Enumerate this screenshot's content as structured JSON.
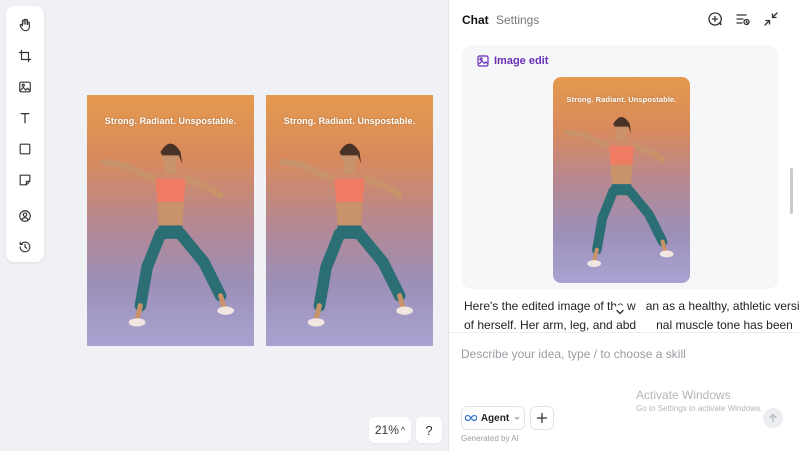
{
  "toolbar": {
    "tools": [
      {
        "icon": "hand-icon"
      },
      {
        "icon": "crop-icon"
      },
      {
        "icon": "image-icon"
      },
      {
        "icon": "text-icon"
      },
      {
        "icon": "rectangle-icon"
      },
      {
        "icon": "sticky-note-icon"
      },
      {
        "icon": "user-circle-icon"
      },
      {
        "icon": "history-icon"
      }
    ]
  },
  "canvas": {
    "poster_left": {
      "headline": "Strong. Radiant. Unspostable."
    },
    "poster_right": {
      "headline": "Strong. Radiant. Unspostable."
    }
  },
  "zoom": {
    "label": "21%",
    "caret": "^"
  },
  "help": {
    "label": "?"
  },
  "panel": {
    "tabs": {
      "chat": "Chat",
      "settings": "Settings"
    },
    "header_icons": [
      "new-chat-icon",
      "chat-history-icon",
      "collapse-icon"
    ],
    "card": {
      "tag": "Image edit",
      "image_headline": "Strong. Radiant. Unspostable."
    },
    "message_line1": "Here's the edited image of the w   an as a healthy, athletic version",
    "message_line2": "of herself. Her arm, leg, and abd      nal muscle tone has been",
    "composer": {
      "placeholder": "Describe your idea, type / to choose a skill",
      "agent_label": "Agent",
      "generated_note": "Generated by AI"
    },
    "watermark": {
      "title": "Activate Windows",
      "subtitle": "Go to Settings to activate Windows."
    }
  },
  "colors": {
    "accent_purple": "#6a2fb5",
    "top_orange": "#e59a4d",
    "bottom_lavender": "#a9a3d1",
    "top_coral": "#ef7b63",
    "leggings_teal": "#2b6f74"
  }
}
